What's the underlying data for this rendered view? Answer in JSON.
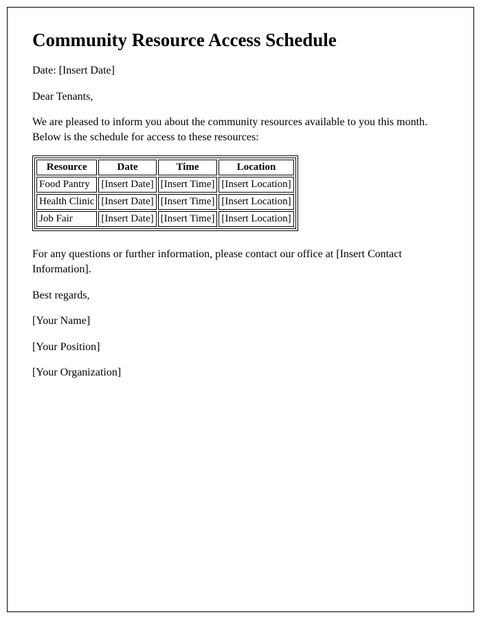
{
  "title": "Community Resource Access Schedule",
  "date_line": "Date: [Insert Date]",
  "salutation": "Dear Tenants,",
  "intro": "We are pleased to inform you about the community resources available to you this month. Below is the schedule for access to these resources:",
  "table": {
    "headers": {
      "resource": "Resource",
      "date": "Date",
      "time": "Time",
      "location": "Location"
    },
    "rows": [
      {
        "resource": "Food Pantry",
        "date": "[Insert Date]",
        "time": "[Insert Time]",
        "location": "[Insert Location]"
      },
      {
        "resource": "Health Clinic",
        "date": "[Insert Date]",
        "time": "[Insert Time]",
        "location": "[Insert Location]"
      },
      {
        "resource": "Job Fair",
        "date": "[Insert Date]",
        "time": "[Insert Time]",
        "location": "[Insert Location]"
      }
    ]
  },
  "contact_line": "For any questions or further information, please contact our office at [Insert Contact Information].",
  "closing": "Best regards,",
  "signature": {
    "name": "[Your Name]",
    "position": "[Your Position]",
    "organization": "[Your Organization]"
  }
}
